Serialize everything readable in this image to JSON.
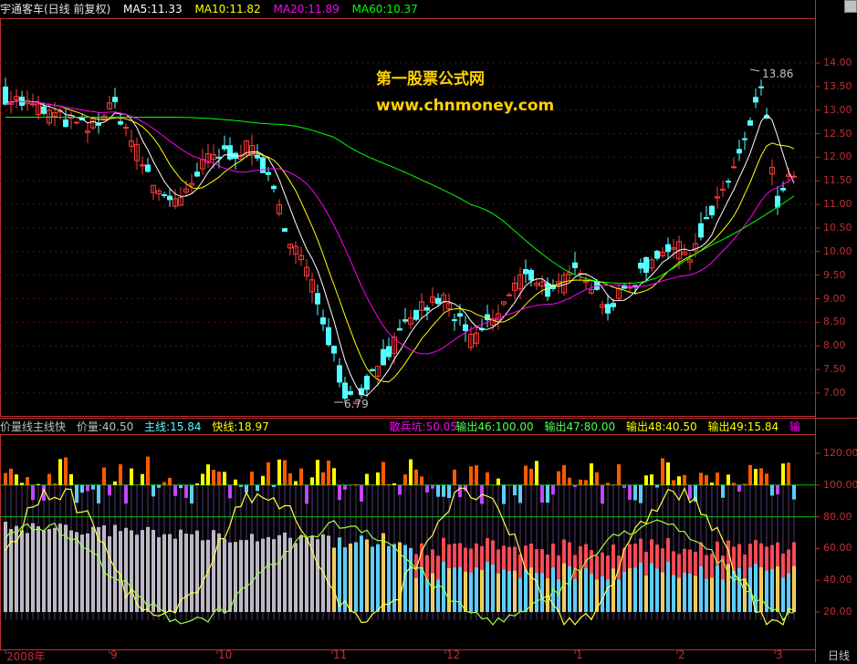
{
  "header": {
    "stock_label": "宇通客车(日线 前复权)",
    "ma5": "MA5:11.33",
    "ma10": "MA10:11.82",
    "ma20": "MA20:11.89",
    "ma60": "MA60:10.37"
  },
  "watermark": {
    "line1": "第一股票公式网",
    "line2": "www.chnmoney.com"
  },
  "price_axis": [
    "14.00",
    "13.50",
    "13.00",
    "12.50",
    "12.00",
    "11.50",
    "11.00",
    "10.50",
    "10.00",
    "9.50",
    "9.00",
    "8.50",
    "8.00",
    "7.50",
    "7.00"
  ],
  "annotations": {
    "high": "13.86",
    "low": "6.79"
  },
  "indicator": {
    "name": "价量线主线快",
    "qty": "价量:40.50",
    "main": "主线:15.84",
    "fast": "快线:18.97",
    "pit": "散兵坑:50.05",
    "out46": "输出46:100.00",
    "out47": "输出47:80.00",
    "out48": "输出48:40.50",
    "out49": "输出49:15.84",
    "out_more": "输"
  },
  "indicator_axis": [
    "120.00",
    "100.00",
    "80.00",
    "60.00",
    "40.00",
    "20.00"
  ],
  "x_labels": [
    "2008年",
    "9",
    "10",
    "11",
    "12",
    "1",
    "2",
    "3"
  ],
  "period_label": "日线",
  "colors": {
    "ma5": "#ffffff",
    "ma10": "#ffff00",
    "ma20": "#ff00ff",
    "ma60": "#00ff00",
    "up": "#ff3b3b",
    "down": "#54ffff",
    "axis": "#c03030"
  }
}
